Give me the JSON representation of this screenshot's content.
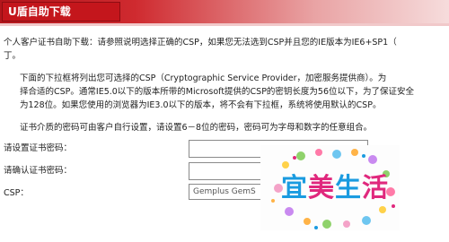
{
  "header": {
    "title": "U盾自助下载"
  },
  "intro": {
    "lines": [
      "个人客户证书自助下载：请参照说明选择正确的CSP，如果您无法选到CSP并且您的IE版本为IE6+SP1（",
      "丁。"
    ]
  },
  "csp_note": {
    "lines": [
      "下面的下拉框将列出您可选择的CSP（Cryptographic Service Provider，加密服务提供商）。为",
      "择合适的CSP。通常IE5.0以下的版本所带的Microsoft提供的CSP的密钥长度为56位以下，为了保证安全",
      "为128位。如果您使用的浏览器为IE3.0以下的版本，将不会有下拉框，系统将使用默认的CSP。"
    ]
  },
  "password_note": {
    "text": "证书介质的密码可由客户自行设置，请设置6－8位的密码，密码可为字母和数字的任意组合。"
  },
  "form": {
    "set_password_label": "请设置证书密码：",
    "set_password_value": "",
    "confirm_password_label": "请确认证书密码：",
    "confirm_password_value": "",
    "csp_label": "CSP：",
    "csp_selected": "Gemplus GemS"
  },
  "watermark": {
    "chars": [
      "宜",
      "美",
      "生",
      "活"
    ],
    "colors": [
      "#1a9be0",
      "#e0287d",
      "#1a9be0",
      "#e0287d"
    ]
  },
  "colors": {
    "header": "#c4161c",
    "header_text": "#ffffff"
  }
}
